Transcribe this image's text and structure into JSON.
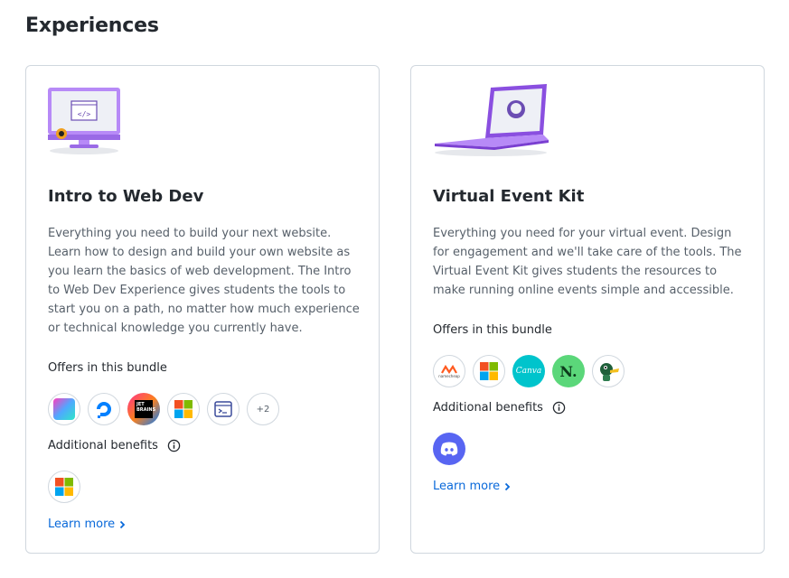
{
  "page": {
    "title": "Experiences"
  },
  "cards": [
    {
      "title": "Intro to Web Dev",
      "description": "Everything you need to build your next website. Learn how to design and build your own website as you learn the basics of web development. The Intro to Web Dev Experience gives students the tools to start you on a path, no matter how much experience or technical knowledge you currently have.",
      "offers_label": "Offers in this bundle",
      "offers": [
        {
          "icon": "gradient-square-icon"
        },
        {
          "icon": "digitalocean-icon"
        },
        {
          "icon": "jetbrains-icon",
          "text": "JET BRAINS"
        },
        {
          "icon": "microsoft-icon"
        },
        {
          "icon": "terminal-window-icon"
        },
        {
          "more": "+2"
        }
      ],
      "benefits_label": "Additional benefits",
      "benefits": [
        {
          "icon": "microsoft-icon"
        }
      ],
      "learn_more": "Learn more"
    },
    {
      "title": "Virtual Event Kit",
      "description": "Everything you need for your virtual event. Design for engagement and we'll take care of the tools. The Virtual Event Kit gives students the resources to make running online events simple and accessible.",
      "offers_label": "Offers in this bundle",
      "offers": [
        {
          "icon": "namecheap-icon",
          "text": "namecheap"
        },
        {
          "icon": "microsoft-icon"
        },
        {
          "icon": "canva-icon",
          "text": "Canva"
        },
        {
          "icon": "n-logo-icon",
          "text": "N."
        },
        {
          "icon": "duck-icon"
        }
      ],
      "benefits_label": "Additional benefits",
      "benefits": [
        {
          "icon": "discord-icon"
        }
      ],
      "learn_more": "Learn more"
    }
  ],
  "colors": {
    "link": "#0969da",
    "microsoft": [
      "#f25022",
      "#7fba00",
      "#00a4ef",
      "#ffb900"
    ],
    "digitalocean": "#0080ff",
    "canva": "#00c4cc",
    "n_logo": "#5bd77a",
    "discord": "#5865f2",
    "illustration_purple": "#a56bf5"
  }
}
